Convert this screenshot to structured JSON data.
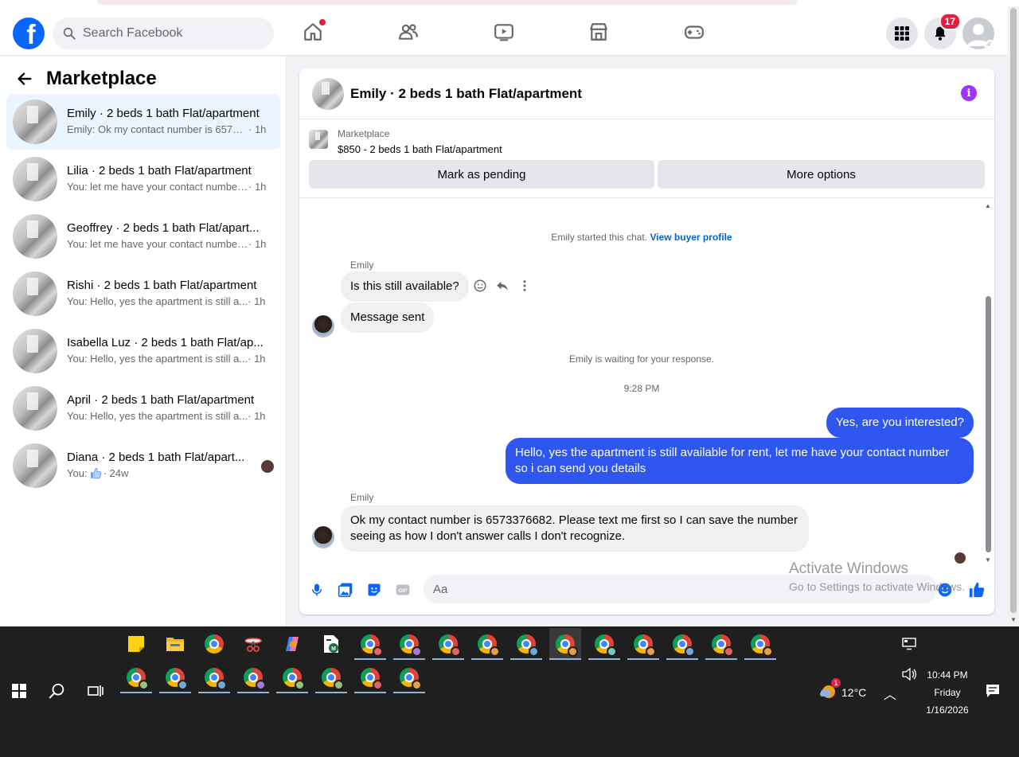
{
  "header": {
    "logo": "f",
    "search_placeholder": "Search Facebook",
    "notification_count": "17",
    "nav_icons": [
      "home-icon",
      "friends-icon",
      "video-icon",
      "marketplace-icon",
      "gaming-icon"
    ]
  },
  "sidebar": {
    "title": "Marketplace",
    "conversations": [
      {
        "name": "Emily · 2 beds 1 bath Flat/apartment",
        "snippet": "Emily: Ok my contact number is 65733...",
        "time": "· 1h",
        "active": true
      },
      {
        "name": "Lilia · 2 beds 1 bath Flat/apartment",
        "snippet": "You: let me have your contact number...",
        "time": "· 1h"
      },
      {
        "name": "Geoffrey · 2 beds 1 bath Flat/apart...",
        "snippet": "You: let me have your contact number...",
        "time": "· 1h"
      },
      {
        "name": "Rishi · 2 beds 1 bath Flat/apartment",
        "snippet": "You: Hello, yes the apartment is still a...",
        "time": "· 1h"
      },
      {
        "name": "Isabella Luz · 2 beds 1 bath Flat/ap...",
        "snippet": "You: Hello, yes the apartment is still a...",
        "time": "· 1h"
      },
      {
        "name": "April · 2 beds 1 bath Flat/apartment",
        "snippet": "You: Hello, yes the apartment is still a...",
        "time": "· 1h"
      },
      {
        "name": "Diana · 2 beds 1 bath Flat/apart...",
        "snippet": "You: ",
        "time": "· 24w"
      }
    ]
  },
  "chat": {
    "title": "Emily · 2 beds 1 bath Flat/apartment",
    "listing_label": "Marketplace",
    "listing_price": "$850 - 2 beds 1 bath Flat/apartment",
    "mark_pending": "Mark as pending",
    "more_options": "More options",
    "started_text": "Emily started this chat.",
    "view_profile": "View buyer profile",
    "sender_name": "Emily",
    "msg1": "Is this still available?",
    "msg2": "Message sent",
    "waiting_text": "Emily is waiting for your response.",
    "time_stamp": "9:28 PM",
    "out1": "Yes, are you interested?",
    "out2": "Hello, yes the apartment is still available for rent, let me have your contact number so i can send you details",
    "msg3": "Ok my contact number is 6573376682. Please text me first so I can save the number seeing as how I don't answer calls I don't recognize.",
    "composer_placeholder": "Aa"
  },
  "watermark": {
    "line1": "Activate Windows",
    "line2": "Go to Settings to activate Windows."
  },
  "taskbar": {
    "weather": "12°C",
    "weather_badge": "1",
    "time": "10:44 PM",
    "day": "Friday",
    "date": "1/16/2026"
  }
}
